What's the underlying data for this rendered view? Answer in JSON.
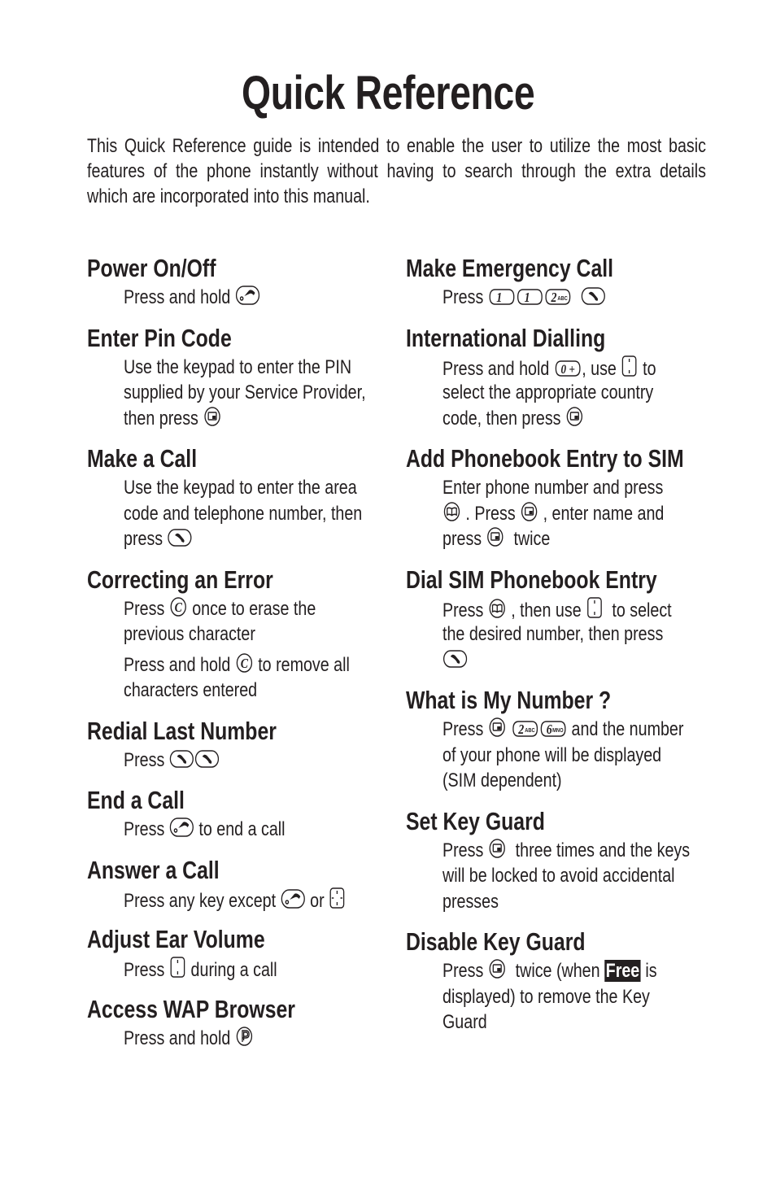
{
  "title": "Quick Reference",
  "intro_lines": [
    "This Quick Reference guide is intended to enable the user to utilize the most basic",
    "features of the phone instantly without having to search through the extra details",
    "which are incorporated into this manual."
  ],
  "icons": {
    "end": "end-power-key-icon",
    "send": "send-call-key-icon",
    "menu": "menu-softkey-icon",
    "clear": "clear-key-icon",
    "nav": "navigation-key-icon",
    "nav4": "four-way-navigation-key-icon",
    "wap": "wap-key-icon",
    "book": "phonebook-key-icon",
    "k1": "key-1-icon",
    "k2": "key-2-abc-icon",
    "k6": "key-6-mno-icon",
    "k0": "key-0-plus-icon"
  },
  "columns": [
    [
      {
        "heading": "Power On/Off",
        "paras": [
          [
            [
              {
                "t": "Press and hold "
              },
              {
                "i": "end"
              }
            ]
          ]
        ]
      },
      {
        "heading": "Enter Pin Code",
        "paras": [
          [
            [
              {
                "t": "Use the keypad to enter the PIN"
              }
            ],
            [
              {
                "t": "supplied by your Service Provider,"
              }
            ],
            [
              {
                "t": "then press "
              },
              {
                "i": "menu"
              }
            ]
          ]
        ]
      },
      {
        "heading": "Make a Call",
        "paras": [
          [
            [
              {
                "t": "Use the keypad to enter the area"
              }
            ],
            [
              {
                "t": "code and telephone number, then"
              }
            ],
            [
              {
                "t": "press "
              },
              {
                "i": "send"
              }
            ]
          ]
        ]
      },
      {
        "heading": "Correcting an Error",
        "paras": [
          [
            [
              {
                "t": "Press "
              },
              {
                "i": "clear"
              },
              {
                "t": " once to erase the"
              }
            ],
            [
              {
                "t": "previous character"
              }
            ]
          ],
          [
            [
              {
                "t": "Press and hold "
              },
              {
                "i": "clear"
              },
              {
                "t": " to remove all"
              }
            ],
            [
              {
                "t": "characters entered"
              }
            ]
          ]
        ]
      },
      {
        "heading": "Redial Last Number",
        "paras": [
          [
            [
              {
                "t": "Press "
              },
              {
                "i": "send"
              },
              {
                "i": "send"
              }
            ]
          ]
        ]
      },
      {
        "heading": "End a Call",
        "paras": [
          [
            [
              {
                "t": "Press "
              },
              {
                "i": "end"
              },
              {
                "t": " to end a call"
              }
            ]
          ]
        ]
      },
      {
        "heading": "Answer a Call",
        "paras": [
          [
            [
              {
                "t": "Press any key except "
              },
              {
                "i": "end"
              },
              {
                "t": " or "
              },
              {
                "i": "nav4"
              }
            ]
          ]
        ]
      },
      {
        "heading": "Adjust Ear Volume",
        "paras": [
          [
            [
              {
                "t": "Press "
              },
              {
                "i": "nav"
              },
              {
                "t": " during a call"
              }
            ]
          ]
        ]
      },
      {
        "heading": "Access WAP Browser",
        "paras": [
          [
            [
              {
                "t": "Press and hold "
              },
              {
                "i": "wap"
              }
            ]
          ]
        ]
      }
    ],
    [
      {
        "heading": "Make Emergency Call",
        "paras": [
          [
            [
              {
                "t": "Press "
              },
              {
                "i": "k1"
              },
              {
                "i": "k1"
              },
              {
                "i": "k2"
              },
              {
                "t": "  "
              },
              {
                "i": "send"
              }
            ]
          ]
        ]
      },
      {
        "heading": "International Dialling",
        "paras": [
          [
            [
              {
                "t": "Press and hold "
              },
              {
                "i": "k0"
              },
              {
                "t": ", use "
              },
              {
                "i": "nav"
              },
              {
                "t": " to"
              }
            ],
            [
              {
                "t": "select the appropriate country"
              }
            ],
            [
              {
                "t": "code, then press "
              },
              {
                "i": "menu"
              }
            ]
          ]
        ]
      },
      {
        "heading": "Add Phonebook Entry to SIM",
        "paras": [
          [
            [
              {
                "t": "Enter phone number and press"
              }
            ],
            [
              {
                "i": "book"
              },
              {
                "t": " . Press "
              },
              {
                "i": "menu"
              },
              {
                "t": " , enter name and"
              }
            ],
            [
              {
                "t": "press "
              },
              {
                "i": "menu"
              },
              {
                "t": "  twice"
              }
            ]
          ]
        ]
      },
      {
        "heading": "Dial SIM Phonebook Entry",
        "paras": [
          [
            [
              {
                "t": "Press "
              },
              {
                "i": "book"
              },
              {
                "t": " , then use "
              },
              {
                "i": "nav"
              },
              {
                "t": "  to select"
              }
            ],
            [
              {
                "t": "the desired number, then press"
              }
            ],
            [
              {
                "i": "send"
              }
            ]
          ]
        ]
      },
      {
        "heading": "What is My Number ?",
        "paras": [
          [
            [
              {
                "t": "Press "
              },
              {
                "i": "menu"
              },
              {
                "t": " "
              },
              {
                "i": "k2"
              },
              {
                "i": "k6"
              },
              {
                "t": " and the number"
              }
            ],
            [
              {
                "t": "of your phone will be displayed"
              }
            ],
            [
              {
                "t": "(SIM dependent)"
              }
            ]
          ]
        ]
      },
      {
        "heading": "Set Key Guard",
        "paras": [
          [
            [
              {
                "t": "Press "
              },
              {
                "i": "menu"
              },
              {
                "t": "  three times and the keys"
              }
            ],
            [
              {
                "t": "will be locked to avoid accidental"
              }
            ],
            [
              {
                "t": "presses"
              }
            ]
          ]
        ]
      },
      {
        "heading": "Disable Key Guard",
        "paras": [
          [
            [
              {
                "t": "Press "
              },
              {
                "i": "menu"
              },
              {
                "t": "  twice (when "
              },
              {
                "hl": "Free"
              },
              {
                "t": " is"
              }
            ],
            [
              {
                "t": "displayed) to remove the Key"
              }
            ],
            [
              {
                "t": "Guard"
              }
            ]
          ]
        ]
      }
    ]
  ]
}
